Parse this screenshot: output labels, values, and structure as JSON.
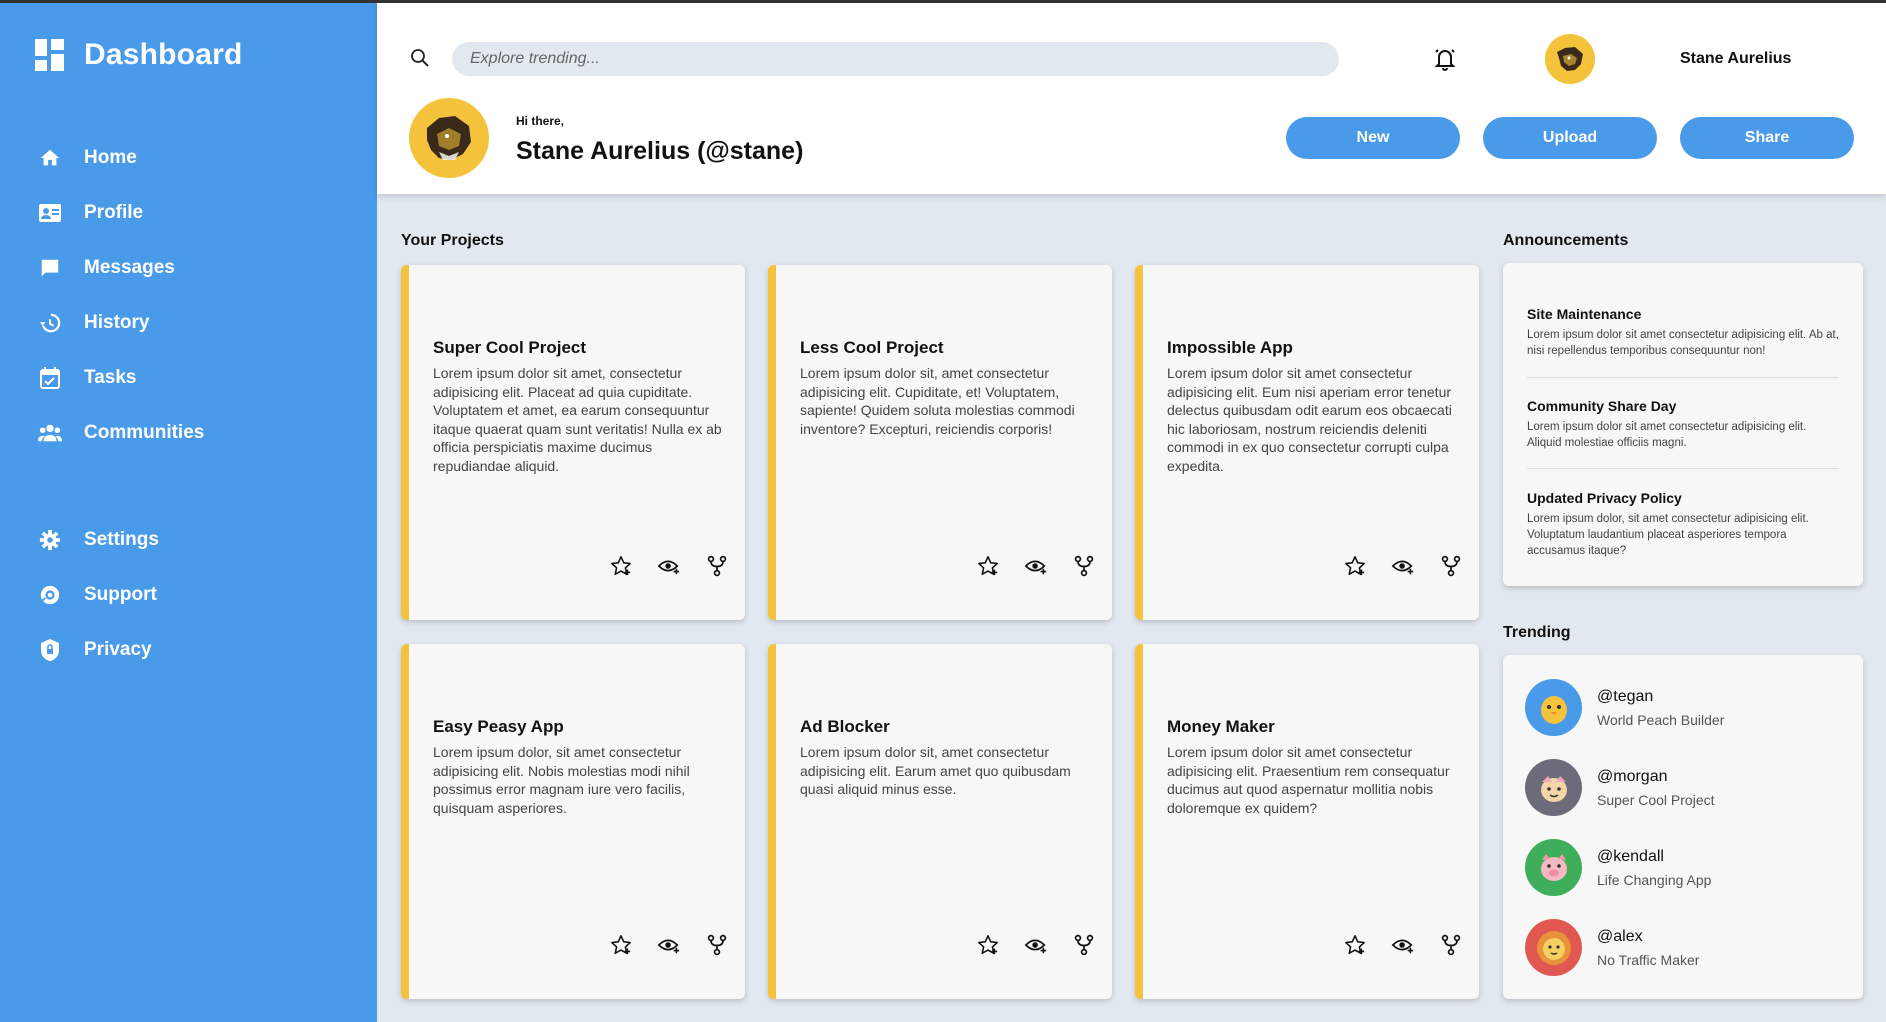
{
  "sidebar": {
    "title": "Dashboard",
    "nav_main": [
      {
        "label": "Home",
        "icon": "home-icon"
      },
      {
        "label": "Profile",
        "icon": "profile-card-icon"
      },
      {
        "label": "Messages",
        "icon": "chat-bubble-icon"
      },
      {
        "label": "History",
        "icon": "history-icon"
      },
      {
        "label": "Tasks",
        "icon": "calendar-check-icon"
      },
      {
        "label": "Communities",
        "icon": "people-icon"
      }
    ],
    "nav_secondary": [
      {
        "label": "Settings",
        "icon": "gear-icon"
      },
      {
        "label": "Support",
        "icon": "support-icon"
      },
      {
        "label": "Privacy",
        "icon": "shield-icon"
      }
    ]
  },
  "header": {
    "search_placeholder": "Explore trending...",
    "username": "Stane Aurelius",
    "greeting": "Hi there,",
    "fullname": "Stane Aurelius (@stane)",
    "buttons": {
      "new": "New",
      "upload": "Upload",
      "share": "Share"
    }
  },
  "projects": {
    "title": "Your Projects",
    "items": [
      {
        "title": "Super Cool Project",
        "desc": "Lorem ipsum dolor sit amet, consectetur adipisicing elit. Placeat ad quia cupiditate. Voluptatem et amet, ea earum consequuntur itaque quaerat quam sunt veritatis! Nulla ex ab officia perspiciatis maxime ducimus repudiandae aliquid."
      },
      {
        "title": "Less Cool Project",
        "desc": "Lorem ipsum dolor sit, amet consectetur adipisicing elit. Cupiditate, et! Voluptatem, sapiente! Quidem soluta molestias commodi inventore? Excepturi, reiciendis corporis!"
      },
      {
        "title": "Impossible App",
        "desc": "Lorem ipsum dolor sit amet consectetur adipisicing elit. Eum nisi aperiam error tenetur delectus quibusdam odit earum eos obcaecati hic laboriosam, nostrum reiciendis deleniti commodi in ex quo consectetur corrupti culpa expedita."
      },
      {
        "title": "Easy Peasy App",
        "desc": "Lorem ipsum dolor, sit amet consectetur adipisicing elit. Nobis molestias modi nihil possimus error magnam iure vero facilis, quisquam asperiores."
      },
      {
        "title": "Ad Blocker",
        "desc": "Lorem ipsum dolor sit, amet consectetur adipisicing elit. Earum amet quo quibusdam quasi aliquid minus esse."
      },
      {
        "title": "Money Maker",
        "desc": "Lorem ipsum dolor sit amet consectetur adipisicing elit. Praesentium rem consequatur ducimus aut quod aspernatur mollitia nobis doloremque ex quidem?"
      }
    ],
    "action_icons": [
      "star-icon",
      "watch-icon",
      "fork-icon"
    ]
  },
  "announcements": {
    "title": "Announcements",
    "items": [
      {
        "title": "Site Maintenance",
        "body": "Lorem ipsum dolor sit amet consectetur adipisicing elit. Ab at, nisi repellendus temporibus consequuntur non!"
      },
      {
        "title": "Community Share Day",
        "body": "Lorem ipsum dolor sit amet consectetur adipisicing elit. Aliquid molestiae officiis magni."
      },
      {
        "title": "Updated Privacy Policy",
        "body": "Lorem ipsum dolor, sit amet consectetur adipisicing elit. Voluptatum laudantium placeat asperiores tempora accusamus itaque?"
      }
    ]
  },
  "trending": {
    "title": "Trending",
    "items": [
      {
        "handle": "@tegan",
        "project": "World Peach Builder",
        "avatar_color": "#4a9aea",
        "avatar_icon": "chick-icon"
      },
      {
        "handle": "@morgan",
        "project": "Super Cool Project",
        "avatar_color": "#6b6b7a",
        "avatar_icon": "creature-icon"
      },
      {
        "handle": "@kendall",
        "project": "Life Changing App",
        "avatar_color": "#3fae5a",
        "avatar_icon": "pig-icon"
      },
      {
        "handle": "@alex",
        "project": "No Traffic Maker",
        "avatar_color": "#e0584f",
        "avatar_icon": "lion-icon"
      }
    ]
  },
  "colors": {
    "sidebar": "#4a9aea",
    "accent_yellow": "#f5c33b",
    "background": "#e2e8f0",
    "card": "#f7f7f7"
  }
}
